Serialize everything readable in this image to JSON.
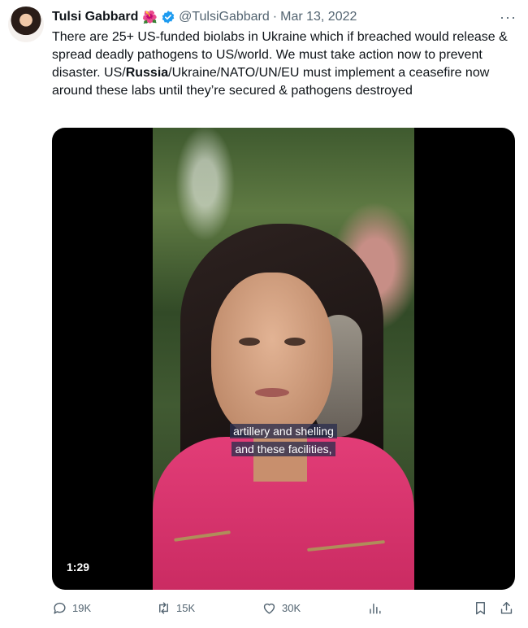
{
  "author": {
    "name": "Tulsi Gabbard",
    "flower_emoji": "🌺",
    "handle": "@TulsiGabbard",
    "separator": "·",
    "date": "Mar 13, 2022"
  },
  "more_icon": "···",
  "tweet": {
    "text_before": "There are 25+ US-funded biolabs in Ukraine which if breached would release & spread deadly pathogens to US/world. We must take action now to prevent disaster. US/",
    "highlight": "Russia",
    "text_after": "/Ukraine/NATO/UN/EU must implement a ceasefire now around these labs until they’re secured & pathogens destroyed"
  },
  "video": {
    "caption_line1": "artillery and shelling",
    "caption_line2": "and these facilities,",
    "duration": "1:29"
  },
  "actions": {
    "replies": "19K",
    "reposts": "15K",
    "likes": "30K"
  },
  "icons": [
    "reply-icon",
    "repost-icon",
    "like-icon",
    "analytics-icon",
    "bookmark-icon",
    "share-icon",
    "verified-badge-icon",
    "more-icon"
  ],
  "colors": {
    "text": "#0f1419",
    "secondary": "#536471",
    "verified": "#1d9bf0"
  }
}
